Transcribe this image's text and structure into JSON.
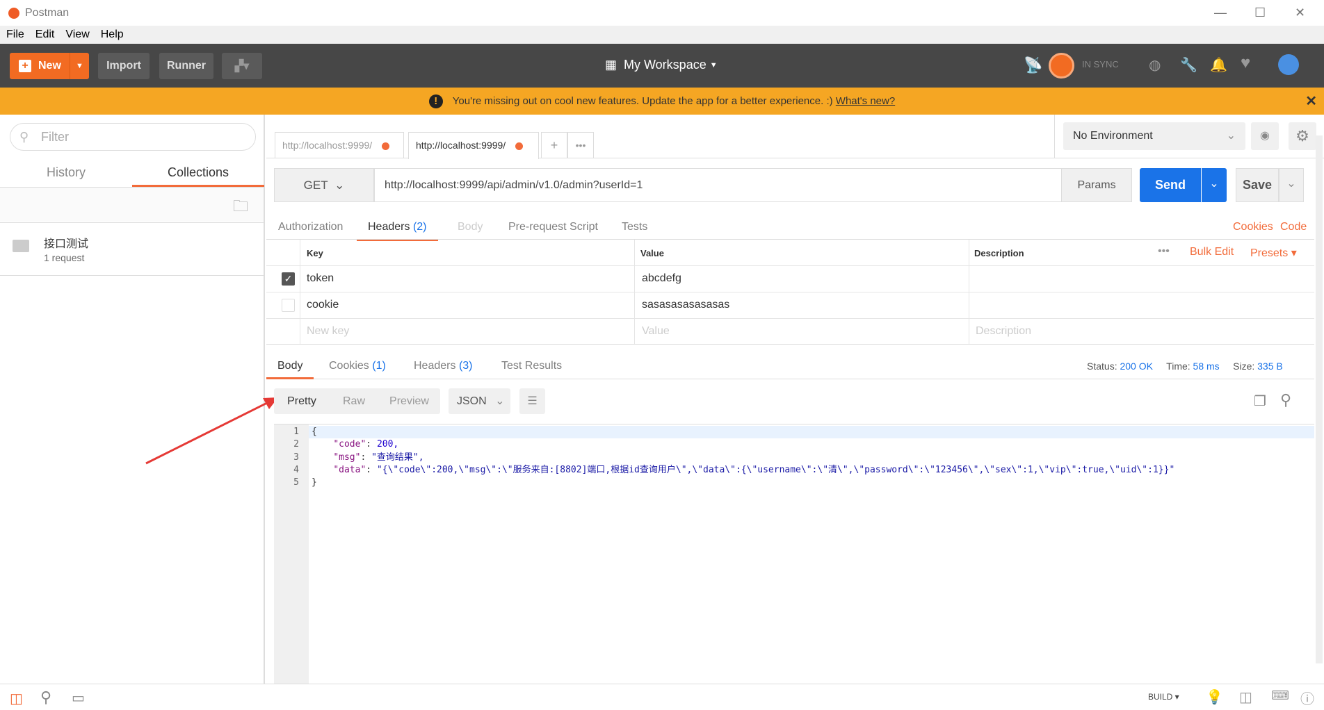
{
  "window": {
    "title": "Postman",
    "minimize": "—",
    "maximize": "☐",
    "close": "✕"
  },
  "menu": [
    "File",
    "Edit",
    "View",
    "Help"
  ],
  "toolbar": {
    "new_label": "New",
    "import_label": "Import",
    "runner_label": "Runner",
    "workspace": "My Workspace",
    "sync_status": "IN SYNC"
  },
  "banner": {
    "text": "You're missing out on cool new features. Update the app for a better experience. :)",
    "link": "What's new?",
    "close": "✕"
  },
  "sidebar": {
    "filter_placeholder": "Filter",
    "tabs": [
      "History",
      "Collections"
    ],
    "active_tab": "Collections",
    "collections": [
      {
        "name": "接口测试",
        "meta": "1 request"
      }
    ]
  },
  "tabs": [
    {
      "label": "http://localhost:9999/"
    },
    {
      "label": "http://localhost:9999/"
    }
  ],
  "environment": {
    "selected": "No Environment"
  },
  "request": {
    "method": "GET",
    "url": "http://localhost:9999/api/admin/v1.0/admin?userId=1",
    "params_label": "Params",
    "send_label": "Send",
    "save_label": "Save",
    "tabs": [
      "Authorization",
      "Headers",
      "Body",
      "Pre-request Script",
      "Tests"
    ],
    "headers_count": "(2)",
    "active_tab": "Headers",
    "cookies_link": "Cookies",
    "code_link": "Code"
  },
  "headers_table": {
    "columns": [
      "Key",
      "Value",
      "Description"
    ],
    "bulk_edit": "Bulk Edit",
    "presets": "Presets",
    "rows": [
      {
        "key": "token",
        "value": "abcdefg",
        "checked": true
      },
      {
        "key": "cookie",
        "value": "sasasasasasasas",
        "checked": false
      }
    ],
    "placeholder": {
      "key": "New key",
      "value": "Value",
      "description": "Description"
    }
  },
  "response": {
    "tabs": [
      "Body",
      "Cookies",
      "Headers",
      "Test Results"
    ],
    "cookies_count": "(1)",
    "headers_count": "(3)",
    "status_label": "Status:",
    "status": "200 OK",
    "time_label": "Time:",
    "time": "58 ms",
    "size_label": "Size:",
    "size": "335 B",
    "views": [
      "Pretty",
      "Raw",
      "Preview"
    ],
    "format": "JSON",
    "lines": [
      {
        "n": "1",
        "text": "{"
      },
      {
        "n": "2",
        "key": "\"code\"",
        "val": "200,",
        "valtype": "n"
      },
      {
        "n": "3",
        "key": "\"msg\"",
        "val": "\"查询结果\",",
        "valtype": "s"
      },
      {
        "n": "4",
        "key": "\"data\"",
        "val": "\"{\\\"code\\\":200,\\\"msg\\\":\\\"服务来自:[8802]端口,根据id查询用户\\\",\\\"data\\\":{\\\"username\\\":\\\"清\\\",\\\"password\\\":\\\"123456\\\",\\\"sex\\\":1,\\\"vip\\\":true,\\\"uid\\\":1}}\"",
        "valtype": "s"
      },
      {
        "n": "5",
        "text": "}"
      }
    ]
  },
  "footer": {
    "build": "BUILD ▾"
  },
  "colors": {
    "accent": "#f26b3a",
    "send": "#1a73e8",
    "banner": "#f5a623",
    "toolbar": "#474747"
  }
}
